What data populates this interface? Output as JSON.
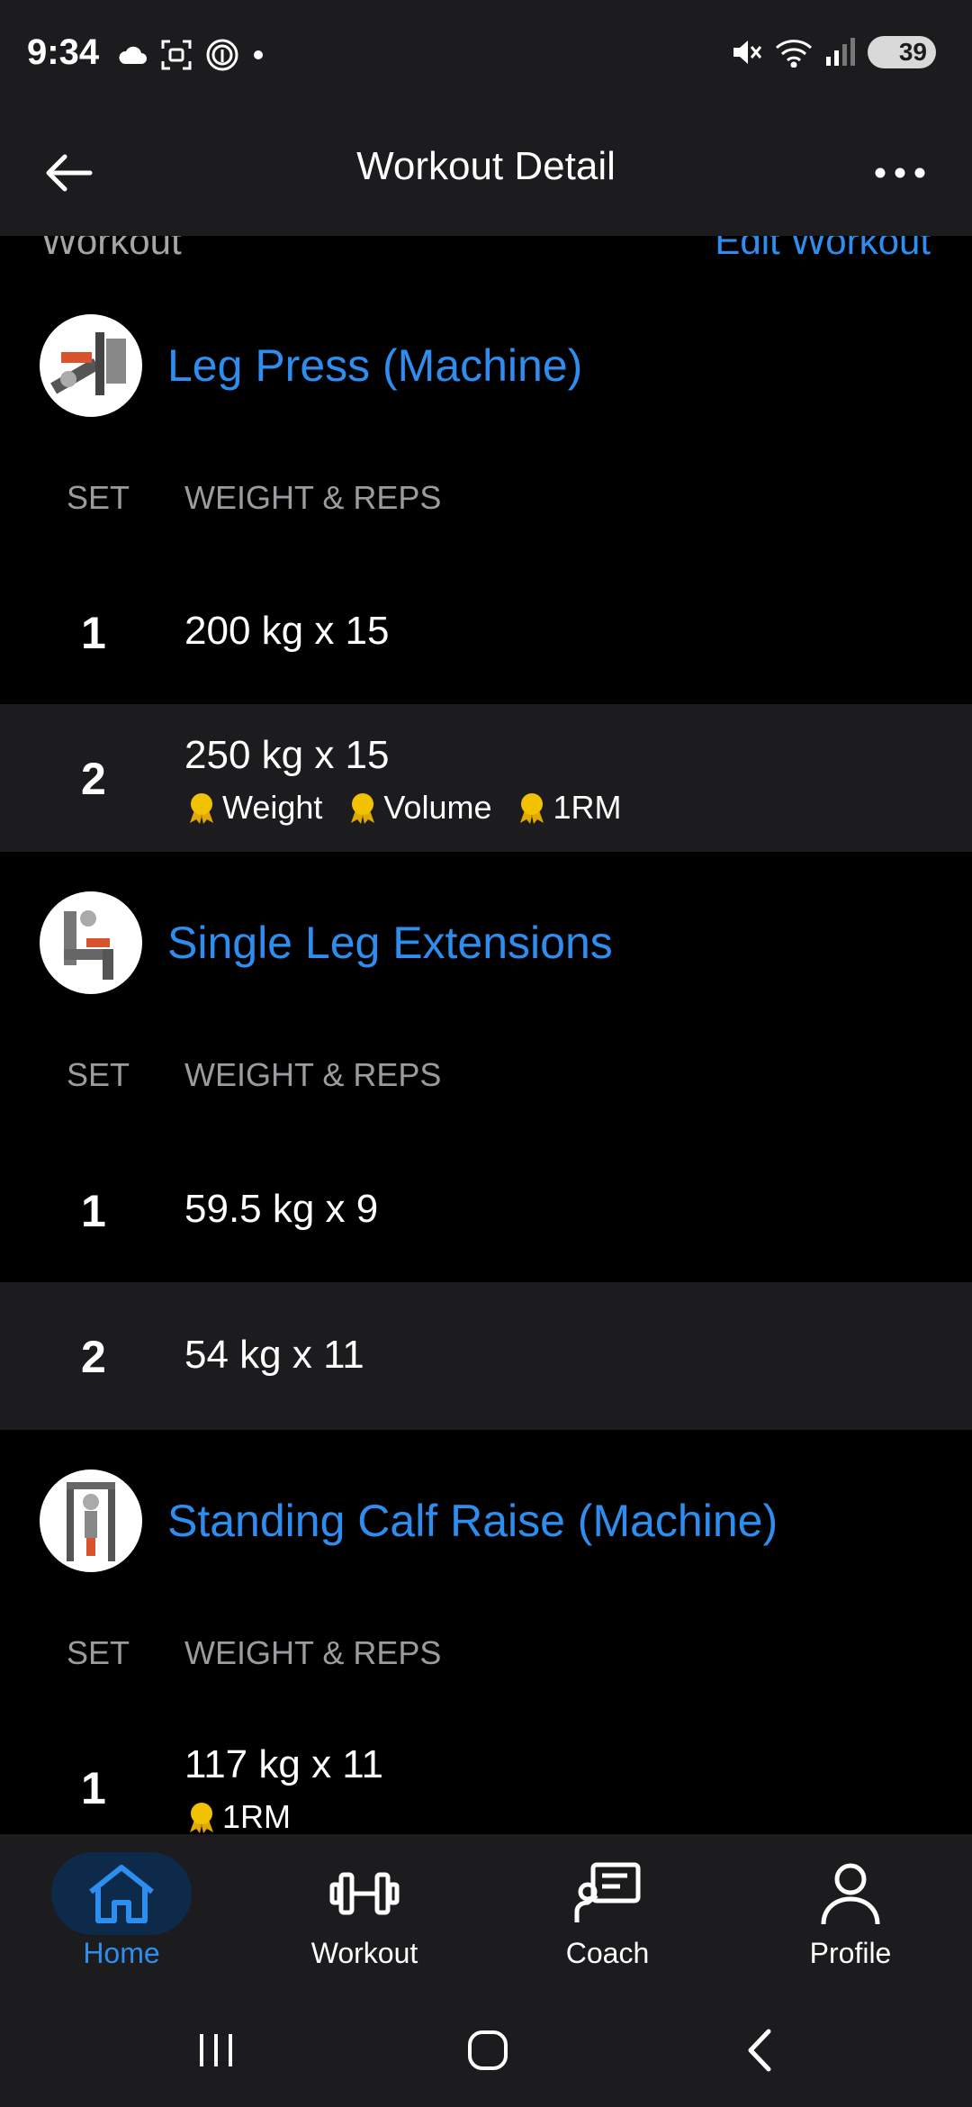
{
  "status_bar": {
    "time": "9:34",
    "battery": "39",
    "left_icons": [
      "cloud-icon",
      "screenshot-icon",
      "fingerprint-icon",
      "dot-icon"
    ],
    "right_icons": [
      "mute-icon",
      "wifi-icon",
      "signal-icon"
    ]
  },
  "header": {
    "title": "Workout Detail"
  },
  "top_row": {
    "left": "Workout",
    "right": "Edit Workout"
  },
  "columns": {
    "set": "SET",
    "weight_reps": "WEIGHT & REPS"
  },
  "exercises": [
    {
      "name": "Leg Press (Machine)",
      "sets": [
        {
          "num": "1",
          "value": "200 kg x 15",
          "badges": []
        },
        {
          "num": "2",
          "value": "250 kg x 15",
          "badges": [
            "Weight",
            "Volume",
            "1RM"
          ]
        }
      ]
    },
    {
      "name": "Single Leg Extensions",
      "sets": [
        {
          "num": "1",
          "value": "59.5 kg x 9",
          "badges": []
        },
        {
          "num": "2",
          "value": "54 kg x 11",
          "badges": []
        }
      ]
    },
    {
      "name": "Standing Calf Raise (Machine)",
      "sets": [
        {
          "num": "1",
          "value": "117 kg x 11",
          "badges": [
            "1RM"
          ]
        }
      ]
    }
  ],
  "bottom_nav": [
    {
      "label": "Home",
      "icon": "home-icon",
      "active": true
    },
    {
      "label": "Workout",
      "icon": "dumbbell-icon",
      "active": false
    },
    {
      "label": "Coach",
      "icon": "coach-icon",
      "active": false
    },
    {
      "label": "Profile",
      "icon": "profile-icon",
      "active": false
    }
  ],
  "colors": {
    "accent": "#2d8ef0",
    "background": "#000000",
    "surface": "#1c1c1e",
    "medal": "#f2c200"
  }
}
